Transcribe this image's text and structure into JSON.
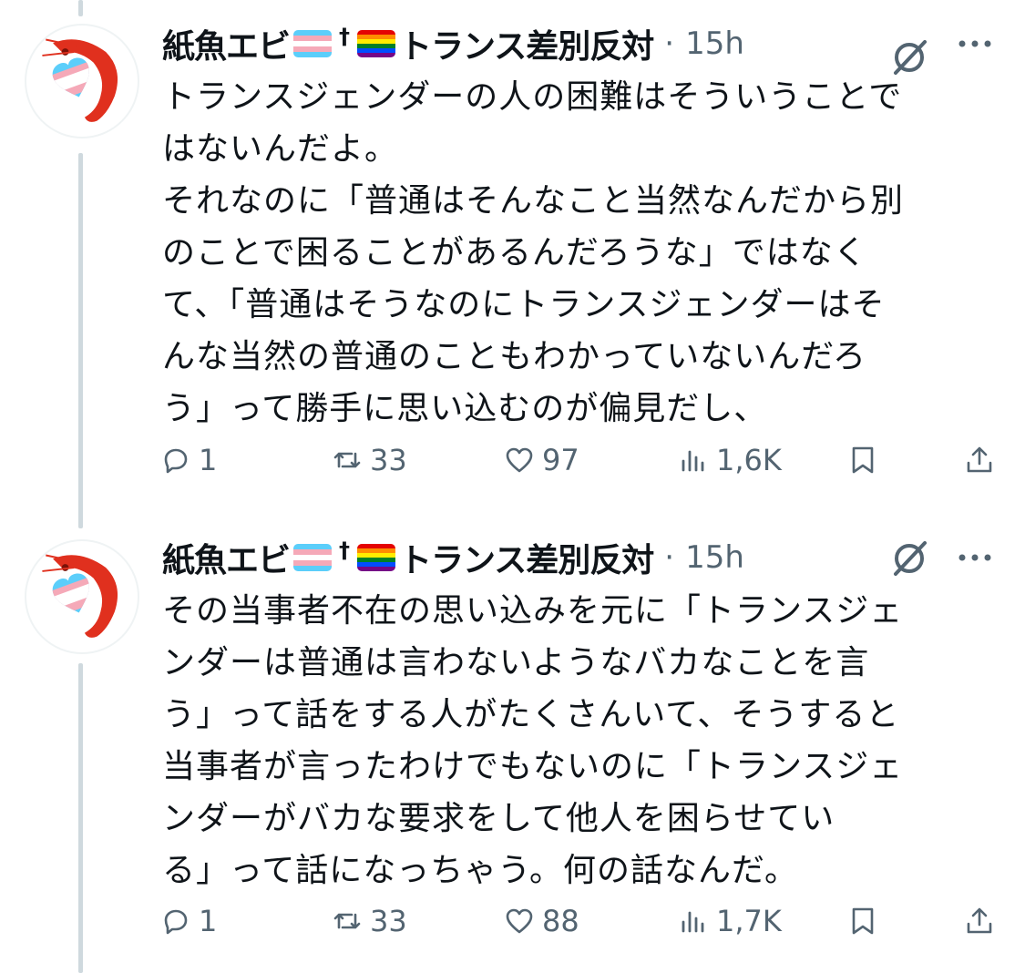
{
  "tweets": [
    {
      "author": "紙魚エビ",
      "name_suffix": "トランス差別反対",
      "dagger": "†",
      "separator": "·",
      "time": "15h",
      "text": "トランスジェンダーの人の困難はそういうことで\nはないんだよ。\nそれなのに「普通はそんなこと当然なんだから別\nのことで困ることがあるんだろうな」ではなく\nて、「普通はそうなのにトランスジェンダーはそ\nんな当然の普通のこともわかっていないんだろ\nう」って勝手に思い込むのが偏見だし、",
      "replies": "1",
      "reposts": "33",
      "likes": "97",
      "views": "1,6K"
    },
    {
      "author": "紙魚エビ",
      "name_suffix": "トランス差別反対",
      "dagger": "†",
      "separator": "·",
      "time": "15h",
      "text": "その当事者不在の思い込みを元に「トランスジェ\nンダーは普通は言わないようなバカなことを言\nう」って話をする人がたくさんいて、そうすると\n当事者が言ったわけでもないのに「トランスジェ\nンダーがバカな要求をして他人を困らせてい\nる」って話になっちゃう。何の話なんだ。",
      "replies": "1",
      "reposts": "33",
      "likes": "88",
      "views": "1,7K"
    }
  ],
  "icons": {
    "reply": "reply-icon",
    "repost": "repost-icon",
    "like": "heart-icon",
    "views": "views-icon",
    "bookmark": "bookmark-icon",
    "share": "share-icon",
    "grok": "grok-icon",
    "more": "more-icon"
  },
  "colors": {
    "text": "#0f1419",
    "secondary": "#536471",
    "thread_line": "#cfd9de",
    "shrimp": "#e0301e"
  }
}
